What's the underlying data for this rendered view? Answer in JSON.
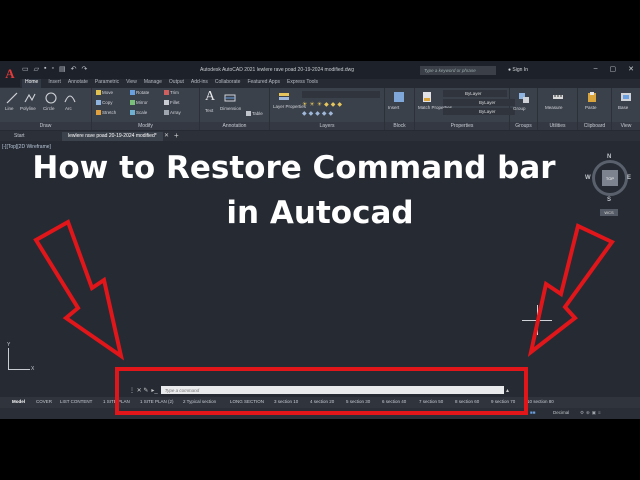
{
  "window": {
    "title": "Autodesk AutoCAD 2021    lewlere rave poad 20-19-2024 modified.dwg",
    "search_placeholder": "Type a keyword or phrase",
    "sign_in": "Sign In"
  },
  "menu_tabs": [
    "Home",
    "Insert",
    "Annotate",
    "Parametric",
    "View",
    "Manage",
    "Output",
    "Add-ins",
    "Collaborate",
    "Featured Apps",
    "Express Tools"
  ],
  "ribbon": {
    "draw": {
      "title": "Draw",
      "tools": [
        "Line",
        "Polyline",
        "Circle",
        "Arc"
      ]
    },
    "modify": {
      "title": "Modify",
      "tools": [
        "Move",
        "Rotate",
        "Trim",
        "Copy",
        "Mirror",
        "Fillet",
        "Stretch",
        "Scale",
        "Array"
      ]
    },
    "annotation": {
      "title": "Annotation",
      "tools": [
        "Text",
        "Dimension",
        "Table"
      ]
    },
    "layers": {
      "title": "Layers",
      "tools": [
        "Layer Properties"
      ]
    },
    "block": {
      "title": "Block",
      "tools": [
        "Insert"
      ]
    },
    "properties": {
      "title": "Properties",
      "tools": [
        "Match Properties"
      ],
      "values": [
        "ByLayer",
        "ByLayer",
        "ByLayer"
      ]
    },
    "groups": {
      "title": "Groups",
      "tools": [
        "Group"
      ]
    },
    "utilities": {
      "title": "Utilities",
      "tools": [
        "Measure"
      ]
    },
    "clipboard": {
      "title": "Clipboard",
      "tools": [
        "Paste"
      ]
    },
    "view": {
      "title": "View",
      "tools": [
        "Base"
      ]
    }
  },
  "doc_tabs": [
    "Start",
    "lewlere rave poad 20-19-2024 modified*"
  ],
  "viewport_label": "[-][Top][2D Wireframe]",
  "headline": {
    "line1": "How to Restore Command bar",
    "line2": "in Autocad"
  },
  "viewcube": {
    "top": "TOP",
    "n": "N",
    "s": "S",
    "e": "E",
    "w": "W",
    "wcs": "WCS"
  },
  "ucs": {
    "x": "X",
    "y": "Y"
  },
  "command": {
    "placeholder": "Type a command"
  },
  "layout_tabs": [
    "Model",
    "COVER",
    "LIST CONTENT",
    "1 SITE PLAN",
    "1 SITE PLAN (2)",
    "2 Typical section",
    "LONG SECTION",
    "3 section 10",
    "4 section 20",
    "5 section 30",
    "6 section 40",
    "7 section 50",
    "8 section 60",
    "9 section 70",
    "10 section 80"
  ],
  "status": {
    "scale": "Decimal"
  },
  "colors": {
    "annotation_red": "#e0161a",
    "app_red": "#e23a3a"
  }
}
